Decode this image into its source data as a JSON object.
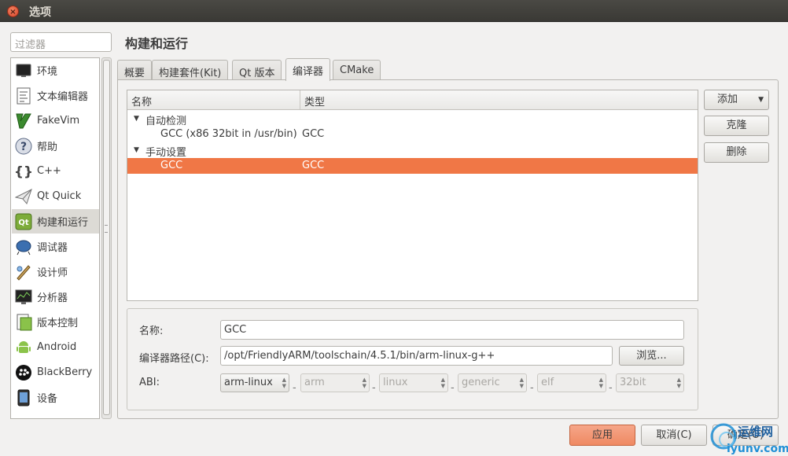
{
  "window": {
    "title": "选项",
    "close_glyph": "×"
  },
  "filter": {
    "placeholder": "过滤器"
  },
  "sidebar": {
    "items": [
      {
        "label": "环境",
        "icon": "monitor-icon"
      },
      {
        "label": "文本编辑器",
        "icon": "text-editor-icon"
      },
      {
        "label": "FakeVim",
        "icon": "fakevim-icon"
      },
      {
        "label": "帮助",
        "icon": "help-icon"
      },
      {
        "label": "C++",
        "icon": "braces-icon"
      },
      {
        "label": "Qt Quick",
        "icon": "paper-plane-icon"
      },
      {
        "label": "构建和运行",
        "icon": "qt-build-icon",
        "selected": true
      },
      {
        "label": "调试器",
        "icon": "debugger-icon"
      },
      {
        "label": "设计师",
        "icon": "designer-icon"
      },
      {
        "label": "分析器",
        "icon": "analyzer-icon"
      },
      {
        "label": "版本控制",
        "icon": "version-control-icon"
      },
      {
        "label": "Android",
        "icon": "android-icon"
      },
      {
        "label": "BlackBerry",
        "icon": "blackberry-icon"
      },
      {
        "label": "设备",
        "icon": "device-icon"
      }
    ]
  },
  "page": {
    "title": "构建和运行"
  },
  "tabs": [
    {
      "label": "概要"
    },
    {
      "label": "构建套件(Kit)"
    },
    {
      "label": "Qt 版本"
    },
    {
      "label": "编译器",
      "active": true
    },
    {
      "label": "CMake"
    }
  ],
  "tree": {
    "headers": [
      "名称",
      "类型"
    ],
    "groups": [
      {
        "label": "自动检测",
        "rows": [
          {
            "name": "GCC (x86 32bit in /usr/bin)",
            "type": "GCC"
          }
        ]
      },
      {
        "label": "手动设置",
        "rows": [
          {
            "name": "GCC",
            "type": "GCC",
            "selected": true
          }
        ]
      }
    ]
  },
  "actions": {
    "add": "添加",
    "clone": "克隆",
    "delete": "删除"
  },
  "details": {
    "name_label": "名称:",
    "name_value": "GCC",
    "path_label": "编译器路径(C):",
    "path_value": "/opt/FriendlyARM/toolschain/4.5.1/bin/arm-linux-g++",
    "browse": "浏览...",
    "abi_label": "ABI:",
    "abi": [
      "arm-linux",
      "arm",
      "linux",
      "generic",
      "elf",
      "32bit"
    ],
    "separator": "-"
  },
  "footer": {
    "apply": "应用",
    "cancel": "取消(C)",
    "ok": "确定(O)"
  },
  "watermark": {
    "line1": "运维网",
    "line2": "iyunv.com"
  },
  "colors": {
    "selection": "#f07746",
    "accent_button": "#ef8962"
  }
}
